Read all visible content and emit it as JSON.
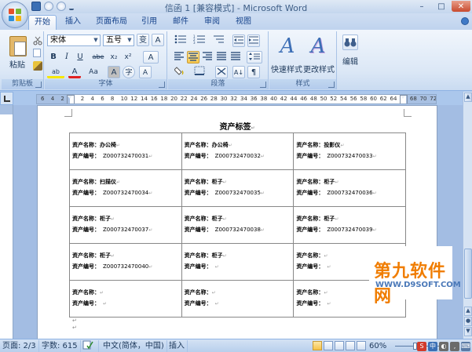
{
  "window": {
    "title": "信函 1 [兼容模式] - Microsoft Word",
    "minimize": "–",
    "maximize": "□",
    "close": "✕"
  },
  "tabs": [
    {
      "label": "开始",
      "active": true
    },
    {
      "label": "插入",
      "active": false
    },
    {
      "label": "页面布局",
      "active": false
    },
    {
      "label": "引用",
      "active": false
    },
    {
      "label": "邮件",
      "active": false
    },
    {
      "label": "审阅",
      "active": false
    },
    {
      "label": "视图",
      "active": false
    }
  ],
  "ribbon": {
    "clipboard": {
      "paste_label": "粘贴",
      "group_label": "剪贴板"
    },
    "font": {
      "font_name": "宋体",
      "font_size": "五号",
      "group_label": "字体",
      "bold": "B",
      "italic": "I",
      "underline": "U",
      "strike": "abe",
      "subscript": "x₂",
      "superscript": "x²",
      "grow": "A",
      "shrink": "A",
      "aa": "Aa",
      "phonetic": "变",
      "clear": "A",
      "char_border": "A",
      "highlight": "ab",
      "color": "A",
      "shade": "A",
      "enclose": "字"
    },
    "paragraph": {
      "group_label": "段落",
      "show_marks": "¶",
      "sort": "A↓"
    },
    "styles": {
      "quick_label": "快速样式",
      "change_label": "更改样式",
      "group_label": "样式"
    },
    "editing": {
      "label": "编辑"
    }
  },
  "ruler": {
    "numbers": [
      "6",
      "4",
      "2",
      "",
      "2",
      "4",
      "6",
      "8",
      "10",
      "12",
      "14",
      "16",
      "18",
      "20",
      "22",
      "24",
      "26",
      "28",
      "30",
      "32",
      "34",
      "36",
      "38",
      "40",
      "42",
      "44",
      "46",
      "48",
      "50",
      "52",
      "54",
      "56",
      "58",
      "60",
      "62",
      "64",
      "",
      "68",
      "70",
      "72"
    ]
  },
  "document": {
    "title": "资产标签",
    "name_label": "资产名称：",
    "code_label": "资产编号：",
    "para_mark": "↵",
    "rows": [
      [
        {
          "name": "办公椅",
          "code": "Z000732470031"
        },
        {
          "name": "办公椅",
          "code": "Z000732470032"
        },
        {
          "name": "投影仪",
          "code": "Z000732470033"
        }
      ],
      [
        {
          "name": "扫描仪",
          "code": "Z000732470034"
        },
        {
          "name": "柜子",
          "code": "Z000732470035"
        },
        {
          "name": "柜子",
          "code": "Z000732470036"
        }
      ],
      [
        {
          "name": "柜子",
          "code": "Z000732470037"
        },
        {
          "name": "柜子",
          "code": "Z000732470038"
        },
        {
          "name": "柜子",
          "code": "Z000732470039"
        }
      ],
      [
        {
          "name": "柜子",
          "code": "Z000732470040"
        },
        {
          "name": "柜子",
          "code": ""
        },
        {
          "name": "",
          "code": ""
        }
      ],
      [
        {
          "name": "",
          "code": ""
        },
        {
          "name": "",
          "code": ""
        },
        {
          "name": "",
          "code": ""
        }
      ]
    ]
  },
  "watermark": {
    "main": "第九软件网",
    "sub": "WWW.D9SOFT.COM"
  },
  "statusbar": {
    "page": "页面: 2/3",
    "words": "字数: 615",
    "language": "中文(简体，中国)",
    "insert_mode": "插入",
    "zoom": "60%"
  },
  "colors": {
    "accent": "#15428b",
    "ribbon": "#dbe7f6",
    "watermark_orange": "#f07d00",
    "watermark_blue": "#4a78b8"
  }
}
